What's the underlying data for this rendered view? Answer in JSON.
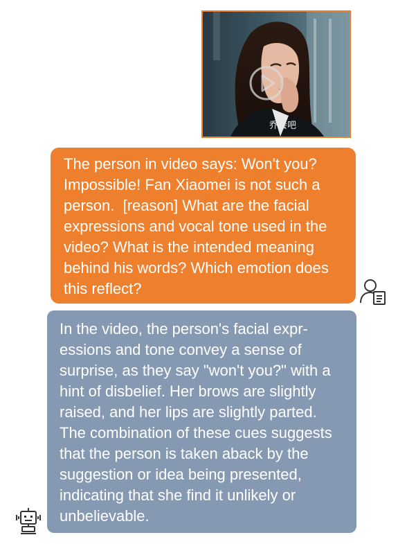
{
  "video": {
    "caption": "乔会吧",
    "play_icon": "play-circle-icon",
    "accent_color": "#ee7f2d"
  },
  "messages": [
    {
      "role": "user",
      "avatar_icon": "user-document-icon",
      "bubble_color": "#ee7f2d",
      "text": "The person in video says: Won't you? Impossible! Fan Xiaomei is not such a person.  [reason] What are the facial expressions and vocal tone used in the video? What is the intended meaning behind his words? Which emotion does this reflect?"
    },
    {
      "role": "assistant",
      "avatar_icon": "robot-icon",
      "bubble_color": "#8599b2",
      "text": "In the video, the person's facial expr-essions and tone convey a sense of surprise, as they say \"won't you?\" with a hint of disbelief. Her brows are slightly raised, and her lips are slightly parted.  The combination of these cues suggests that the person is taken aback by the suggestion or idea being presented, indicating that she find it unlikely or unbelievable."
    }
  ]
}
